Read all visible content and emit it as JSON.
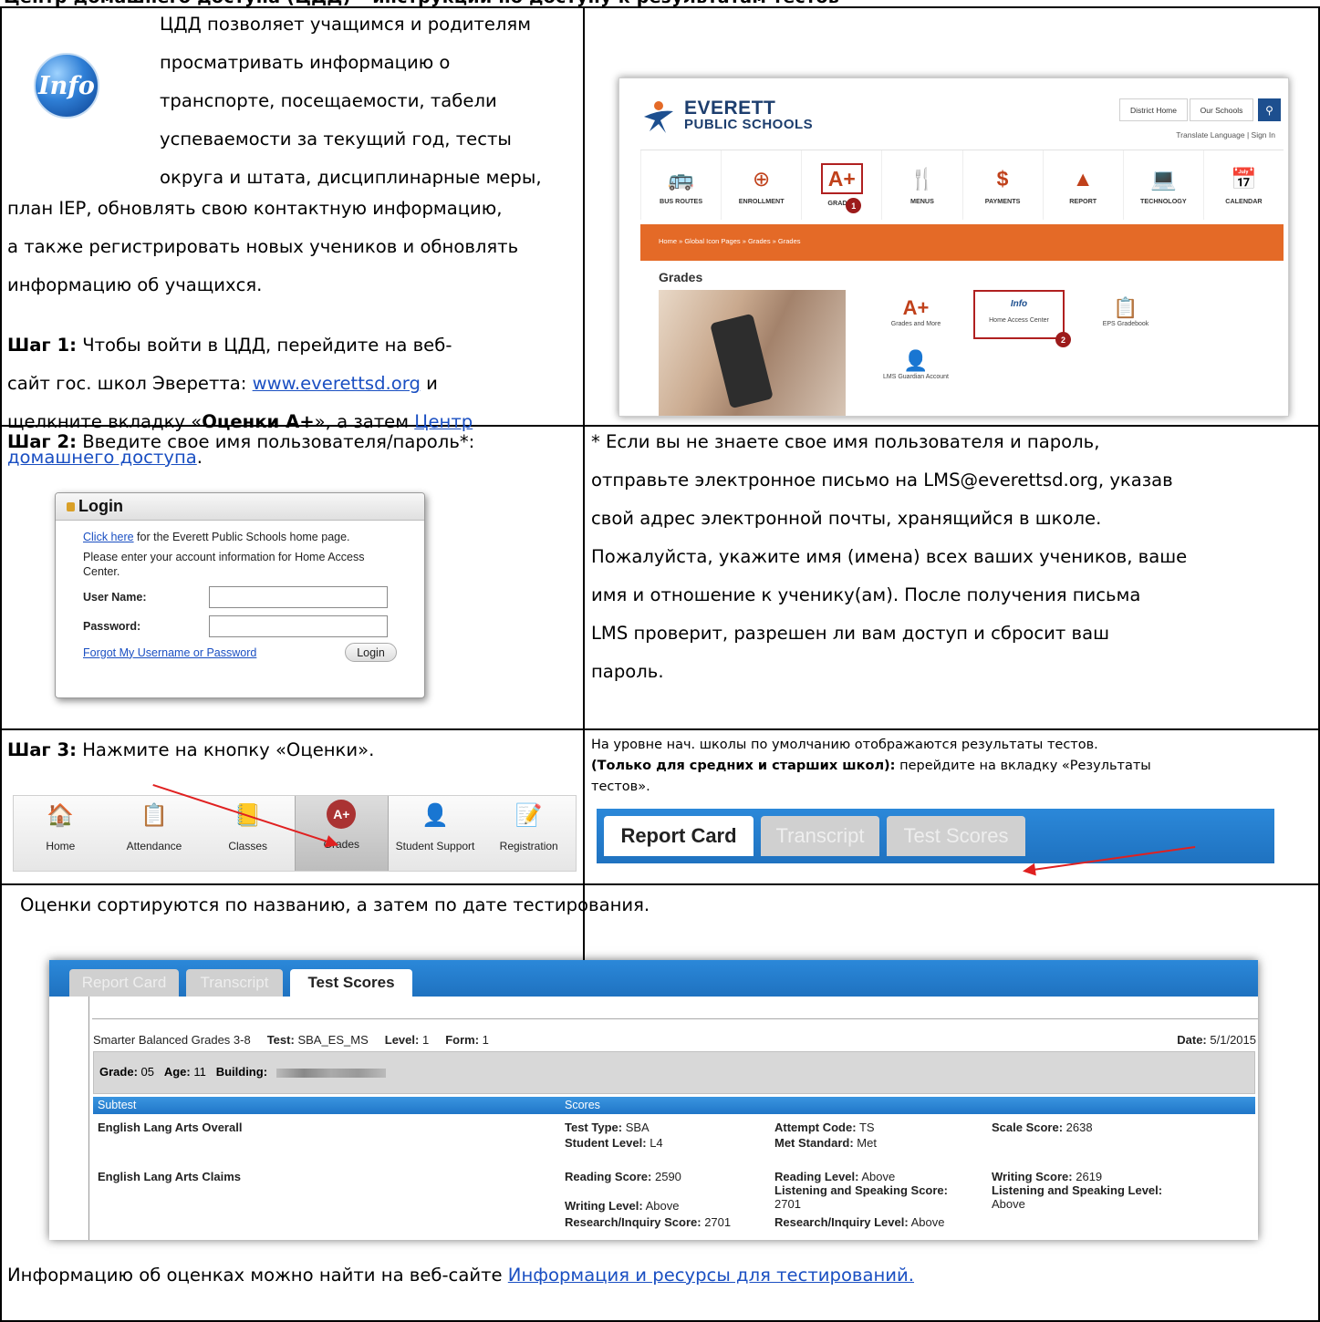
{
  "header_strip": "Центр домашнего доступа (ЦДД) – инструкции по доступу к результатам тестов",
  "intro": {
    "p1_line1": "ЦДД позволяет учащимся и родителям",
    "p1_line2": "просматривать информацию о",
    "p1_line3": "транспорте, посещаемости, табели",
    "p1_line4": "успеваемости за текущий год, тесты",
    "p1_line5": "округа и штата, дисциплинарные меры,",
    "p1_line6": "план IEP, обновлять свою контактную информацию,",
    "p1_line7": "а также регистрировать новых учеников и обновлять",
    "p1_line8": "информацию об учащихся."
  },
  "info_icon_label": "Info",
  "step1": {
    "label": "Шаг 1:",
    "text1": " Чтобы войти в ЦДД, перейдите на веб-",
    "text2": "сайт гос. школ Эверетта: ",
    "link1": "www.everettsd.org",
    "text3": " и",
    "text4": "щелкните вкладку «",
    "bold": "Оценки A+",
    "text5": "», а затем ",
    "link2a": "Центр",
    "link2b": "домашнего доступа",
    "text6": "."
  },
  "eps_site": {
    "logo_line1": "EVERETT",
    "logo_line2": "PUBLIC SCHOOLS",
    "btn_district": "District Home",
    "btn_schools": "Our Schools",
    "search_icon": "magnifier",
    "translate": "Translate Language  |  Sign In",
    "icons": [
      {
        "glyph": "🚌",
        "label": "BUS ROUTES"
      },
      {
        "glyph": "⊕",
        "label": "ENROLLMENT"
      },
      {
        "glyph": "A+",
        "label": "GRADES"
      },
      {
        "glyph": "🍴",
        "label": "MENUS"
      },
      {
        "glyph": "$",
        "label": "PAYMENTS"
      },
      {
        "glyph": "▲",
        "label": "REPORT"
      },
      {
        "glyph": "💻",
        "label": "TECHNOLOGY"
      },
      {
        "glyph": "📅",
        "label": "CALENDAR"
      }
    ],
    "badge1": "1",
    "breadcrumb": "Home  »  Global Icon Pages  »  Grades  »  Grades",
    "grades_title": "Grades",
    "tiles": [
      {
        "glyph": "A+",
        "label": "Grades and More"
      },
      {
        "glyph": "Info",
        "label": "Home Access Center"
      },
      {
        "glyph": "📋",
        "label": "EPS Gradebook"
      },
      {
        "glyph": "👤",
        "label": "LMS Guardian Account"
      }
    ],
    "badge2": "2"
  },
  "step2": {
    "label": "Шаг 2:",
    "text": " Введите свое имя пользователя/пароль*:"
  },
  "login": {
    "title": "Login",
    "link": "Click here",
    "line1": " for the Everett Public Schools home page.",
    "line2": "Please enter your account information for Home Access Center.",
    "user_label": "User Name:",
    "pass_label": "Password:",
    "forgot": "Forgot My Username or Password",
    "button": "Login"
  },
  "note": {
    "l1": "* Если вы не знаете свое имя пользователя и пароль,",
    "l2": "отправьте электронное письмо на LMS@everettsd.org, указав",
    "l3": "свой адрес электронной почты, хранящийся в школе.",
    "l4": "Пожалуйста, укажите имя (имена) всех ваших учеников, ваше",
    "l5": "имя и отношение к ученику(ам). После получения письма",
    "l6": "LMS проверит, разрешен ли вам доступ и сбросит ваш",
    "l7": "пароль."
  },
  "step3": {
    "label": "Шаг 3:",
    "text": " Нажмите на кнопку «Оценки»."
  },
  "hac_nav": [
    {
      "icon": "house-icon",
      "glyph": "🏠",
      "label": "Home"
    },
    {
      "icon": "checklist-icon",
      "glyph": "📋",
      "label": "Attendance"
    },
    {
      "icon": "notebook-icon",
      "glyph": "📒",
      "label": "Classes"
    },
    {
      "icon": "grades-icon",
      "glyph": "A+",
      "label": "Grades"
    },
    {
      "icon": "person-icon",
      "glyph": "👤",
      "label": "Student Support"
    },
    {
      "icon": "registration-icon",
      "glyph": "📝",
      "label": "Registration"
    }
  ],
  "elem_note": {
    "l1": "На уровне нач. школы по умолчанию отображаются результаты тестов.",
    "bold": "(Только для средних и старших школ):",
    "l2": " перейдите на вкладку «Результаты",
    "l3": "тестов»."
  },
  "tabs": {
    "report": "Report Card",
    "transcript": "Transcript",
    "tests": "Test Scores"
  },
  "sort_note": "Оценки сортируются по названию, а затем по дате тестирования.",
  "test": {
    "name": "Smarter Balanced Grades 3-8",
    "test_lbl": "Test:",
    "test_val": "SBA_ES_MS",
    "level_lbl": "Level:",
    "level_val": "1",
    "form_lbl": "Form:",
    "form_val": "1",
    "date_lbl": "Date:",
    "date_val": "5/1/2015",
    "grade_lbl": "Grade:",
    "grade_val": "05",
    "age_lbl": "Age:",
    "age_val": "11",
    "building_lbl": "Building:",
    "col_subtest": "Subtest",
    "col_scores": "Scores",
    "row1_name": "English Lang Arts Overall",
    "r1_a_lbl": "Test Type:",
    "r1_a_val": "SBA",
    "r1_b_lbl": "Attempt Code:",
    "r1_b_val": "TS",
    "r1_c_lbl": "Scale Score:",
    "r1_c_val": "2638",
    "r1_d_lbl": "Student Level:",
    "r1_d_val": "L4",
    "r1_e_lbl": "Met Standard:",
    "r1_e_val": "Met",
    "row2_name": "English Lang Arts Claims",
    "r2_a_lbl": "Reading Score:",
    "r2_a_val": "2590",
    "r2_b_lbl": "Reading Level:",
    "r2_b_val": "Above",
    "r2_c_lbl": "Writing Score:",
    "r2_c_val": "2619",
    "r2_d_lbl": "Listening and Speaking Score:",
    "r2_d_val": "2701",
    "r2_e_lbl": "Listening and Speaking Level:",
    "r2_e_val": "Above",
    "r2_f_lbl": "Writing Level:",
    "r2_f_val": "Above",
    "r2_g_lbl": "Research/Inquiry Score:",
    "r2_g_val": "2701",
    "r2_h_lbl": "Research/Inquiry Level:",
    "r2_h_val": "Above"
  },
  "footer": {
    "text": "Информацию об оценках можно найти на веб-сайте ",
    "link": "Информация и ресурсы для тестирований."
  }
}
